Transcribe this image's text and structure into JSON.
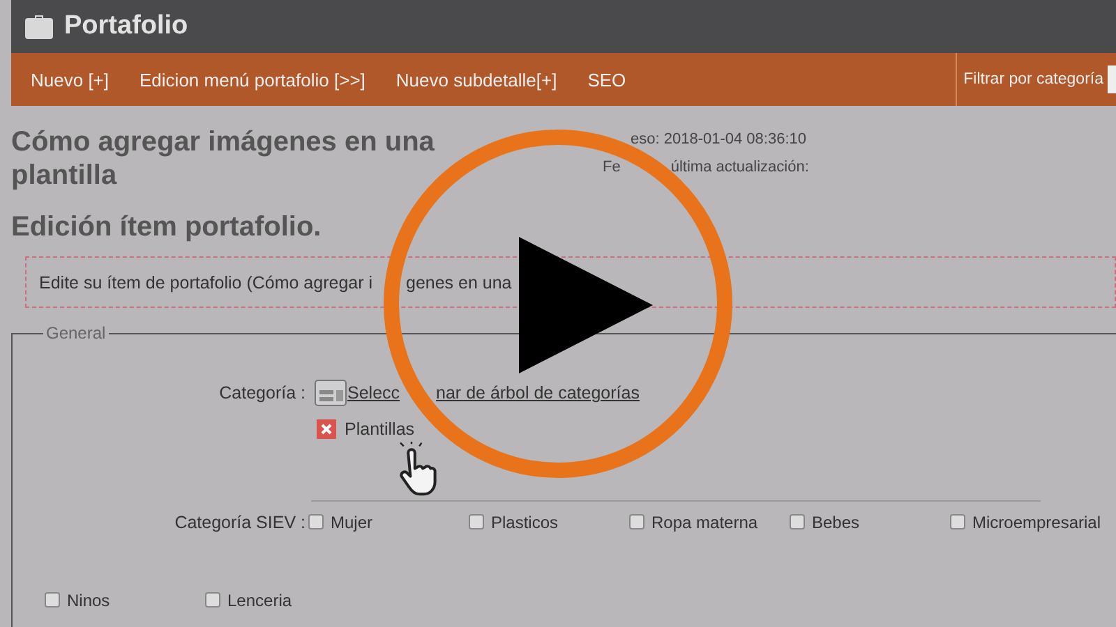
{
  "header": {
    "title": "Portafolio"
  },
  "nav": {
    "items": [
      {
        "label": "Nuevo [+]"
      },
      {
        "label": "Edicion menú portafolio [>>]"
      },
      {
        "label": "Nuevo subdetalle[+]"
      },
      {
        "label": "SEO"
      }
    ],
    "filter_label": "Filtrar por categoría"
  },
  "page_title": "Cómo agregar imágenes en una plantilla",
  "meta": {
    "created_fragment": "eso: 2018-01-04 08:36:10",
    "updated_prefix": "Fe",
    "updated_fragment": "última actualización:"
  },
  "section_title": "Edición ítem portafolio.",
  "notice": {
    "text_start": "Edite su ítem de portafolio (Cómo agregar i",
    "text_end": "genes en una"
  },
  "fieldset": {
    "legend": "General",
    "category": {
      "label": "Categoría :",
      "link_start": "Selecc",
      "link_end": "nar de árbol de categorías",
      "selected_items": [
        "Plantillas"
      ]
    },
    "siev": {
      "label": "Categoría SIEV :",
      "options": [
        {
          "label": "Mujer",
          "checked": false
        },
        {
          "label": "Plasticos",
          "checked": false
        },
        {
          "label": "Ropa materna",
          "checked": false
        },
        {
          "label": "Bebes",
          "checked": false
        },
        {
          "label": "Microempresarial",
          "checked": false
        }
      ],
      "more_options": [
        {
          "label": "Ninos",
          "checked": false
        },
        {
          "label": "Lenceria",
          "checked": false
        }
      ]
    }
  }
}
